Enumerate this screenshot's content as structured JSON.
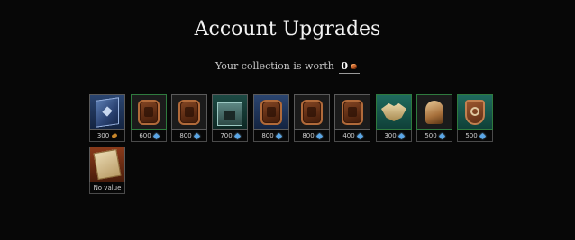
{
  "title": "Account Upgrades",
  "collection": {
    "prefix": "Your collection is worth",
    "value": "0",
    "currency_icon": "coin-icon"
  },
  "items": [
    {
      "name": "blue-tome",
      "price": "300",
      "currency": "coin",
      "icon": "book-icon"
    },
    {
      "name": "badge-a",
      "price": "600",
      "currency": "gem",
      "icon": "badge-icon"
    },
    {
      "name": "badge-b",
      "price": "800",
      "currency": "gem",
      "icon": "badge-icon"
    },
    {
      "name": "building",
      "price": "700",
      "currency": "gem",
      "icon": "building-icon"
    },
    {
      "name": "badge-c",
      "price": "800",
      "currency": "gem",
      "icon": "badge-icon"
    },
    {
      "name": "badge-d",
      "price": "800",
      "currency": "gem",
      "icon": "badge-icon"
    },
    {
      "name": "badge-e",
      "price": "400",
      "currency": "gem",
      "icon": "badge-icon"
    },
    {
      "name": "winged-emblem",
      "price": "300",
      "currency": "gem",
      "icon": "wing-icon"
    },
    {
      "name": "helmet",
      "price": "500",
      "currency": "gem",
      "icon": "helmet-icon"
    },
    {
      "name": "shield",
      "price": "500",
      "currency": "gem",
      "icon": "shield-icon"
    },
    {
      "name": "scroll",
      "price": "No value",
      "currency": "none",
      "icon": "scroll-icon"
    }
  ],
  "colors": {
    "background": "#070707",
    "owned_border": "#2f7a3e",
    "gem": "#5aa6e6",
    "coin": "#c8632a"
  }
}
